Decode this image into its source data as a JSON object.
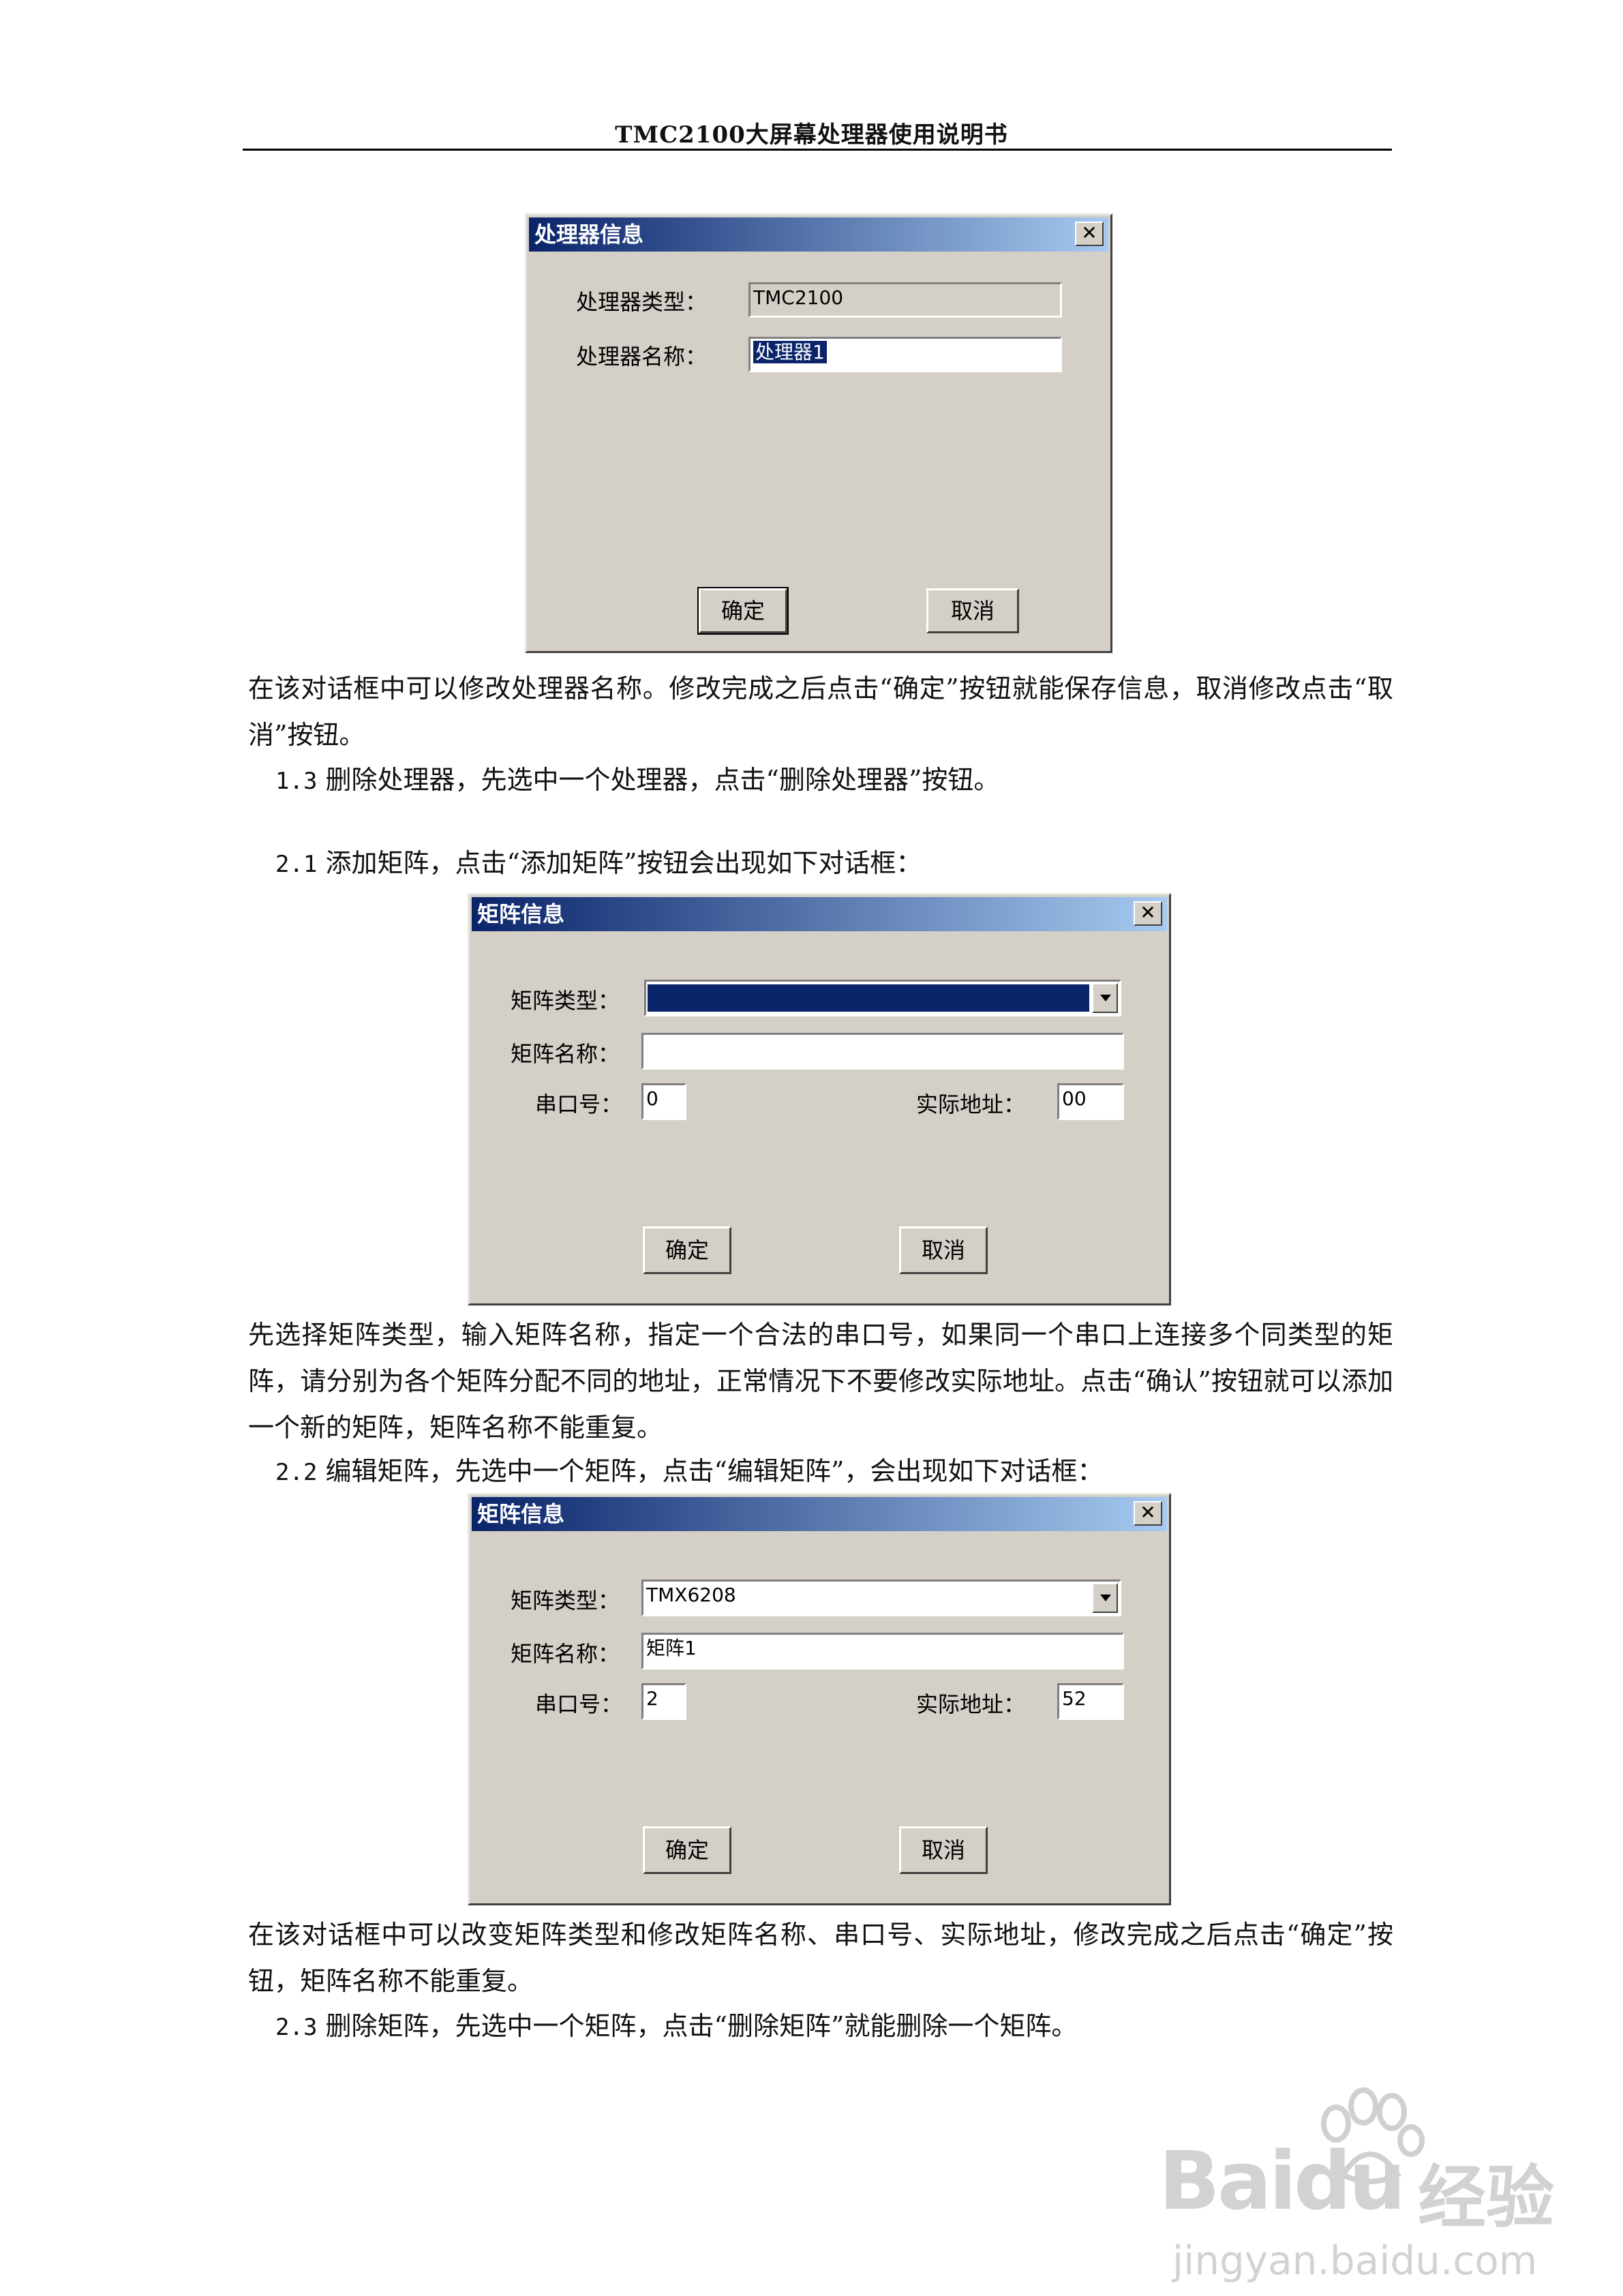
{
  "header": {
    "title": "TMC2100大屏幕处理器使用说明书"
  },
  "dialog1": {
    "title": "处理器信息",
    "type_label": "处理器类型：",
    "type_value": "TMC2100",
    "name_label": "处理器名称：",
    "name_value": "处理器1",
    "ok": "确定",
    "cancel": "取消",
    "close": "✕"
  },
  "para1": "在该对话框中可以修改处理器名称。修改完成之后点击“确定”按钮就能保存信息，取消修改点击“取消”按钮。",
  "step13": {
    "num": "1.3",
    "text": "删除处理器，先选中一个处理器，点击“删除处理器”按钮。"
  },
  "step21": {
    "num": "2.1",
    "text": "添加矩阵，点击“添加矩阵”按钮会出现如下对话框："
  },
  "dialog2": {
    "title": "矩阵信息",
    "type_label": "矩阵类型：",
    "type_value": "",
    "name_label": "矩阵名称：",
    "name_value": "",
    "port_label": "串口号：",
    "port_value": "0",
    "addr_label": "实际地址：",
    "addr_value": "00",
    "ok": "确定",
    "cancel": "取消",
    "close": "✕"
  },
  "para2": "先选择矩阵类型，输入矩阵名称，指定一个合法的串口号，如果同一个串口上连接多个同类型的矩阵，请分别为各个矩阵分配不同的地址，正常情况下不要修改实际地址。点击“确认”按钮就可以添加一个新的矩阵，矩阵名称不能重复。",
  "step22": {
    "num": "2.2",
    "text": "编辑矩阵，先选中一个矩阵，点击“编辑矩阵”，会出现如下对话框："
  },
  "dialog3": {
    "title": "矩阵信息",
    "type_label": "矩阵类型：",
    "type_value": "TMX6208",
    "name_label": "矩阵名称：",
    "name_value": "矩阵1",
    "port_label": "串口号：",
    "port_value": "2",
    "addr_label": "实际地址：",
    "addr_value": "52",
    "ok": "确定",
    "cancel": "取消",
    "close": "✕"
  },
  "para3": "在该对话框中可以改变矩阵类型和修改矩阵名称、串口号、实际地址，修改完成之后点击“确定”按钮，矩阵名称不能重复。",
  "step23": {
    "num": "2.3",
    "text": "删除矩阵，先选中一个矩阵，点击“删除矩阵”就能删除一个矩阵。"
  },
  "watermark": {
    "brand": "Bai",
    "brand2": "du",
    "cn": "经验",
    "url": "jingyan.baidu.com"
  }
}
